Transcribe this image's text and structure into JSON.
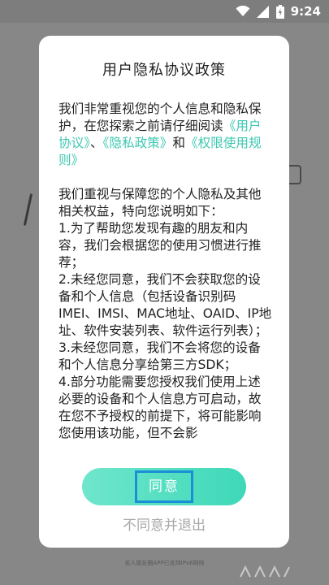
{
  "status": {
    "time": "9:24",
    "icons": [
      "wifi-icon",
      "signal-icon",
      "battery-icon"
    ]
  },
  "background": {
    "footer": "名人朋友圈APP已支持IPv6网络"
  },
  "dialog": {
    "title": "用户隐私协议政策",
    "intro_text": "我们非常重视您的个人信息和隐私保护，在您探索之前请仔细阅读",
    "link_user_agreement": "《用户协议》",
    "separator": "、",
    "link_privacy_policy": "《隐私政策》",
    "and_text": "和",
    "link_permission_rules": "《权限使用规则》",
    "para1": "我们重视与保障您的个人隐私及其他相关权益，特向您说明如下：",
    "item1": "1.为了帮助您发现有趣的朋友和内容，我们会根据您的使用习惯进行推荐；",
    "item2": "2.未经您同意，我们不会获取您的设备和个人信息（包括设备识别码IMEI、IMSI、MAC地址、OAID、IP地址、软件安装列表、软件运行列表）；",
    "item3": "3.未经您同意，我们不会将您的设备和个人信息分享给第三方SDK；",
    "item4": "4.部分功能需要您授权我们使用上述必要的设备和个人信息方可启动，故在您不予授权的前提下，将可能影响您使用该功能，但不会影",
    "agree_label": "同意",
    "reject_label": "不同意并退出"
  },
  "colors": {
    "accent": "#3ec7b2",
    "button_start": "#6fe6cc",
    "button_end": "#3ed8b8",
    "focus_outline": "#1a8fd6"
  }
}
